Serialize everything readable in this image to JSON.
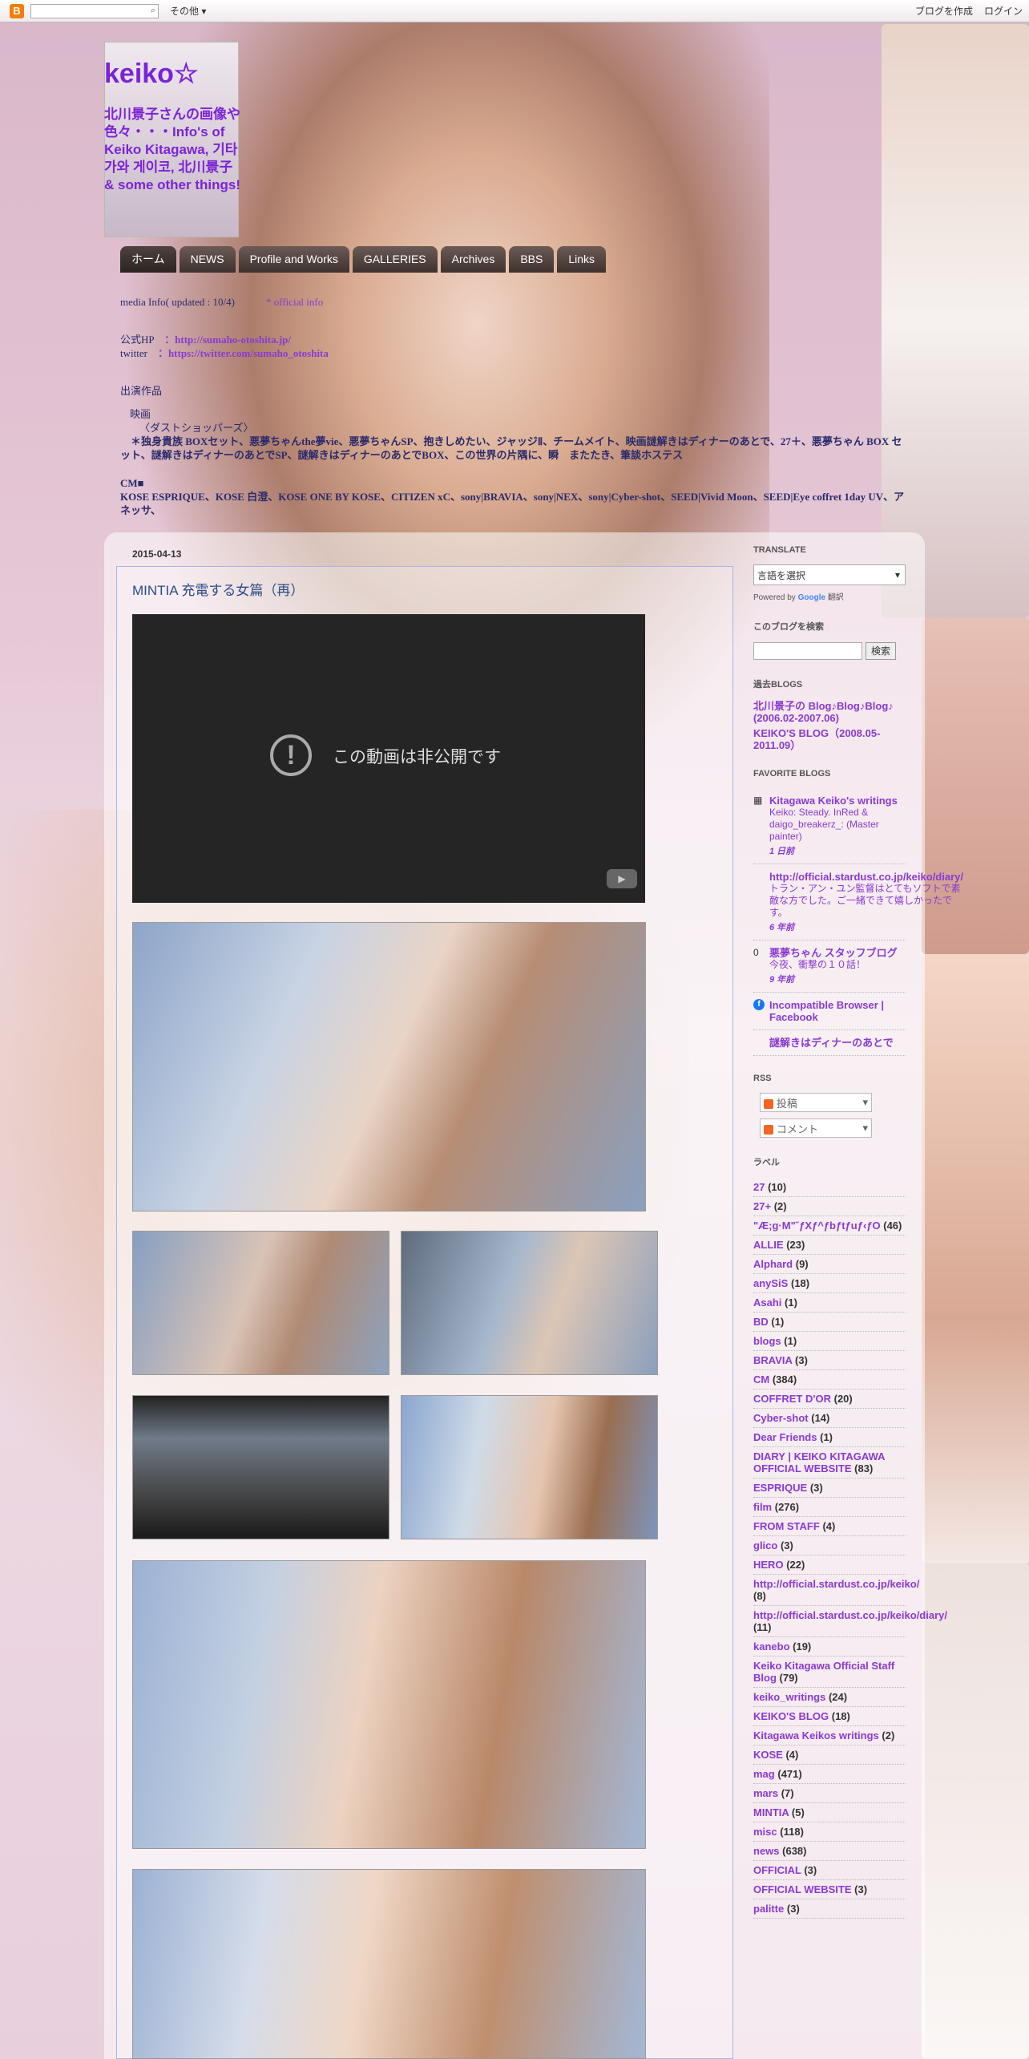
{
  "navbar": {
    "logo": "B",
    "search_icon": "search-icon",
    "more": "その他 ▾",
    "create": "ブログを作成",
    "login": "ログイン"
  },
  "header": {
    "title": "keiko☆",
    "description": "北川景子さんの画像や色々・・・Info's of Keiko Kitagawa, 기타가와 게이코, 北川景子 & some other things!"
  },
  "tabs": [
    "ホーム",
    "NEWS",
    "Profile and Works",
    "GALLERIES",
    "Archives",
    "BBS",
    "Links"
  ],
  "info": {
    "line1a": "media Info( updated : 10/4)",
    "line1b": "* official info",
    "line2a": "公式HP",
    "line2b": "：http://sumaho-otoshita.jp/",
    "line3a": "twitter",
    "line3b": "：https://twitter.com/sumaho_otoshita",
    "line4": "出演作品",
    "line5": "映画",
    "line6": "〈ダストショッパーズ〉",
    "line7": "　＊独身貴族 BOXセット、悪夢ちゃんthe夢vie、悪夢ちゃんSP、抱きしめたい、ジャッジⅡ、チームメイト、映画謎解きはディナーのあとで、27＋、悪夢ちゃん BOX セット、謎解きはディナーのあとでSP、謎解きはディナーのあとでBOX、この世界の片隅に、瞬　またたき、筆談ホステス",
    "line8": "CM■",
    "line9": "KOSE ESPRIQUE、KOSE 白澄、KOSE ONE BY KOSE、CITIZEN xC、sony|BRAVIA、sony|NEX、sony|Cyber-shot、SEED|Vivid Moon、SEED|Eye coffret 1day UV、アネッサ、"
  },
  "post": {
    "date": "2015-04-13",
    "title": "MINTIA 充電する女篇（再）",
    "video_message": "この動画は非公開です",
    "video_icon": "alert-circle-icon"
  },
  "sidebar": {
    "translate": {
      "heading": "Translate",
      "select": "言語を選択",
      "powered_prefix": "Powered by",
      "google": "Google",
      "translate": "翻訳"
    },
    "search": {
      "heading": "このブログを検索",
      "button": "検索"
    },
    "past": {
      "heading": "過去BLOGS",
      "links": [
        "北川景子の Blog♪Blog♪Blog♪ (2006.02-2007.06)",
        "KEIKO'S BLOG（2008.05-2011.09）"
      ]
    },
    "favorites": {
      "heading": "Favorite Blogs",
      "items": [
        {
          "icon": "blog-icon",
          "title": "Kitagawa Keiko's writings",
          "snippet": "Keiko: Steady. InRed & daigo_breakerz_: (Master painter)",
          "age": "1 日前"
        },
        {
          "icon": "",
          "title": "http://official.stardust.co.jp/keiko/diary/",
          "snippet": "トラン・アン・ユン監督はとてもソフトで素敵な方でした。ご一緒できて嬉しかったです。",
          "age": "6 年前"
        },
        {
          "icon": "ameba-icon",
          "title": "悪夢ちゃん スタッフブログ",
          "snippet": "今夜、衝撃の１０話！",
          "age": "9 年前"
        },
        {
          "icon": "facebook-icon",
          "title": "Incompatible Browser | Facebook",
          "snippet": "",
          "age": ""
        },
        {
          "icon": "",
          "title": "謎解きはディナーのあとで",
          "snippet": "",
          "age": ""
        }
      ]
    },
    "rss": {
      "heading": "RSS",
      "posts": "投稿",
      "comments": "コメント"
    },
    "labels": {
      "heading": "ラベル",
      "items": [
        {
          "name": "27",
          "count": "(10)"
        },
        {
          "name": "27+",
          "count": "(2)"
        },
        {
          "name": "\"Æ;g·M\"˘ƒXƒ^ƒbƒtƒuƒ‹ƒO",
          "count": "(46)"
        },
        {
          "name": "ALLIE",
          "count": "(23)"
        },
        {
          "name": "Alphard",
          "count": "(9)"
        },
        {
          "name": "anySiS",
          "count": "(18)"
        },
        {
          "name": "Asahi",
          "count": "(1)"
        },
        {
          "name": "BD",
          "count": "(1)"
        },
        {
          "name": "blogs",
          "count": "(1)"
        },
        {
          "name": "BRAVIA",
          "count": "(3)"
        },
        {
          "name": "CM",
          "count": "(384)"
        },
        {
          "name": "COFFRET D'OR",
          "count": "(20)"
        },
        {
          "name": "Cyber-shot",
          "count": "(14)"
        },
        {
          "name": "Dear Friends",
          "count": "(1)"
        },
        {
          "name": "DIARY | KEIKO KITAGAWA OFFICIAL WEBSITE",
          "count": "(83)"
        },
        {
          "name": "ESPRIQUE",
          "count": "(3)"
        },
        {
          "name": "film",
          "count": "(276)"
        },
        {
          "name": "FROM STAFF",
          "count": "(4)"
        },
        {
          "name": "glico",
          "count": "(3)"
        },
        {
          "name": "HERO",
          "count": "(22)"
        },
        {
          "name": "http://official.stardust.co.jp/keiko/",
          "count": "(8)"
        },
        {
          "name": "http://official.stardust.co.jp/keiko/diary/",
          "count": "(11)"
        },
        {
          "name": "kanebo",
          "count": "(19)"
        },
        {
          "name": "Keiko Kitagawa Official Staff Blog",
          "count": "(79)"
        },
        {
          "name": "keiko_writings",
          "count": "(24)"
        },
        {
          "name": "KEIKO'S BLOG",
          "count": "(18)"
        },
        {
          "name": "Kitagawa Keikos writings",
          "count": "(2)"
        },
        {
          "name": "KOSE",
          "count": "(4)"
        },
        {
          "name": "mag",
          "count": "(471)"
        },
        {
          "name": "mars",
          "count": "(7)"
        },
        {
          "name": "MINTIA",
          "count": "(5)"
        },
        {
          "name": "misc",
          "count": "(118)"
        },
        {
          "name": "news",
          "count": "(638)"
        },
        {
          "name": "OFFICIAL",
          "count": "(3)"
        },
        {
          "name": "OFFICIAL WEBSITE",
          "count": "(3)"
        },
        {
          "name": "palitte",
          "count": "(3)"
        }
      ]
    }
  }
}
